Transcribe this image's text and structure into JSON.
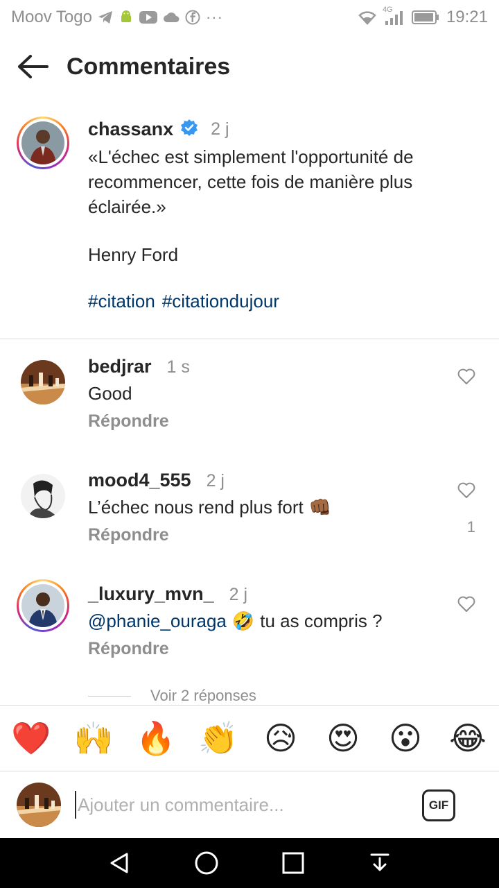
{
  "status_bar": {
    "carrier": "Moov Togo",
    "network": "4G",
    "time": "19:21"
  },
  "header": {
    "title": "Commentaires"
  },
  "post": {
    "username": "chassanx",
    "time": "2 j",
    "verified": true,
    "text": "«L'échec est simplement l'opportunité de recommencer, cette fois de manière plus éclairée.»",
    "author": "Henry Ford",
    "hashtags": [
      "#citation",
      "#citationdujour"
    ]
  },
  "comments": [
    {
      "username": "bedjrar",
      "time": "1 s",
      "text": "Good",
      "reply_label": "Répondre",
      "likes": ""
    },
    {
      "username": "mood4_555",
      "time": "2 j",
      "text": "L’échec nous rend plus fort",
      "emoji": "👊🏾",
      "reply_label": "Répondre",
      "likes": "1"
    },
    {
      "username": "_luxury_mvn_",
      "time": "2 j",
      "mention": "@phanie_ouraga",
      "emoji": "🤣",
      "text": "tu as compris ?",
      "reply_label": "Répondre",
      "likes": ""
    }
  ],
  "view_replies": "Voir 2 réponses",
  "emoji_bar": [
    "❤️",
    "🙌",
    "🔥",
    "👏",
    "😥",
    "😍",
    "😮",
    "😂"
  ],
  "composer": {
    "placeholder": "Ajouter un commentaire...",
    "gif_label": "GIF"
  },
  "colors": {
    "link": "#00376b",
    "verified": "#3897f0",
    "secondary_text": "#8e8e8e"
  }
}
